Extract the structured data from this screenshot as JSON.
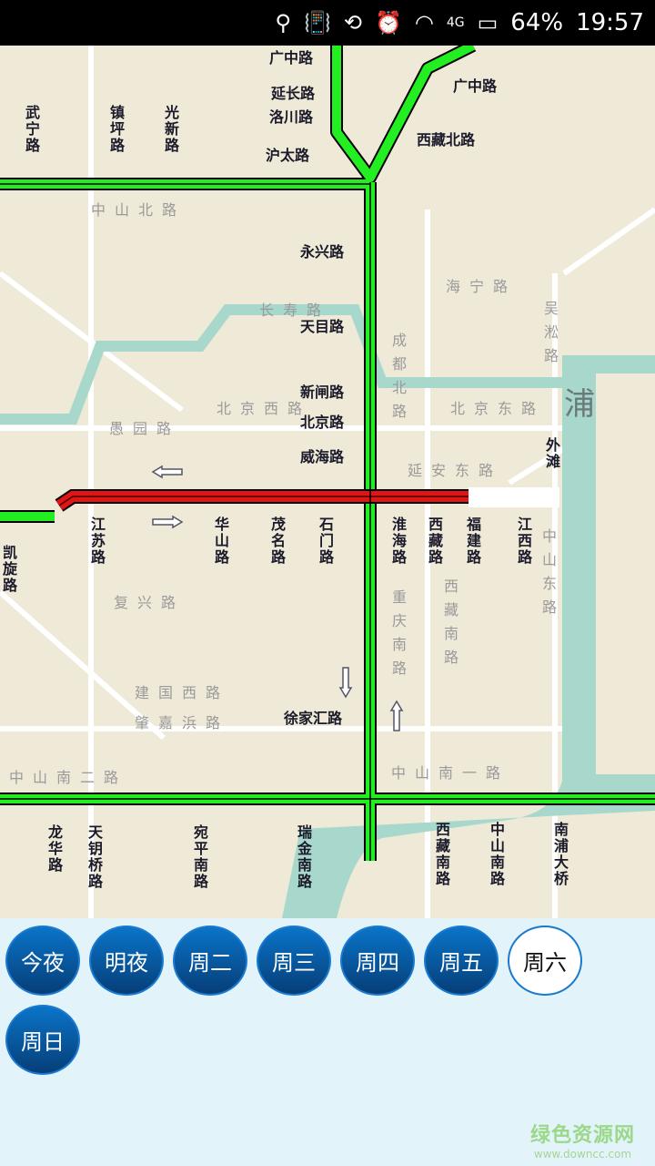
{
  "status_bar": {
    "battery": "64%",
    "time": "19:57",
    "network": "4G",
    "icons": [
      "location-icon",
      "vibrate-icon",
      "rotate-icon",
      "alarm-icon",
      "wifi-icon",
      "signal-icon",
      "battery-icon"
    ]
  },
  "map": {
    "colors": {
      "smooth": "#22ee22",
      "congested": "#e01515",
      "water": "#a8d8cc",
      "land": "#efe9d8"
    },
    "labels": [
      "广中路",
      "延长路",
      "洛川路",
      "沪太路",
      "广中路",
      "西藏北路",
      "永兴路",
      "天目路",
      "新闸路",
      "北京路",
      "威海路",
      "徐家汇路",
      "武宁路",
      "镇坪路",
      "光新路",
      "江苏路",
      "华山路",
      "茂名路",
      "石门路",
      "淮海路",
      "西藏路",
      "福建路",
      "江西路",
      "凯旋路",
      "龙华路",
      "天钥桥路",
      "宛平南路",
      "瑞金南路",
      "西藏南路",
      "中山南路",
      "南浦大桥",
      "外滩",
      "中山北路",
      "海宁路",
      "长寿路",
      "北京西路",
      "北京东路",
      "愚园路",
      "延安东路",
      "复兴路",
      "建国西路",
      "肇嘉浜路",
      "中山南二路",
      "中山南一路",
      "浦",
      "成都北路",
      "重庆南路",
      "西藏南路",
      "中山东路",
      "吴淞路"
    ]
  },
  "days": [
    {
      "label": "今夜"
    },
    {
      "label": "明夜"
    },
    {
      "label": "周二"
    },
    {
      "label": "周三"
    },
    {
      "label": "周四"
    },
    {
      "label": "周五"
    },
    {
      "label": "周六",
      "selected": true
    },
    {
      "label": "周日"
    }
  ],
  "watermark": {
    "title": "绿色资源网",
    "url": "www.downcc.com"
  }
}
